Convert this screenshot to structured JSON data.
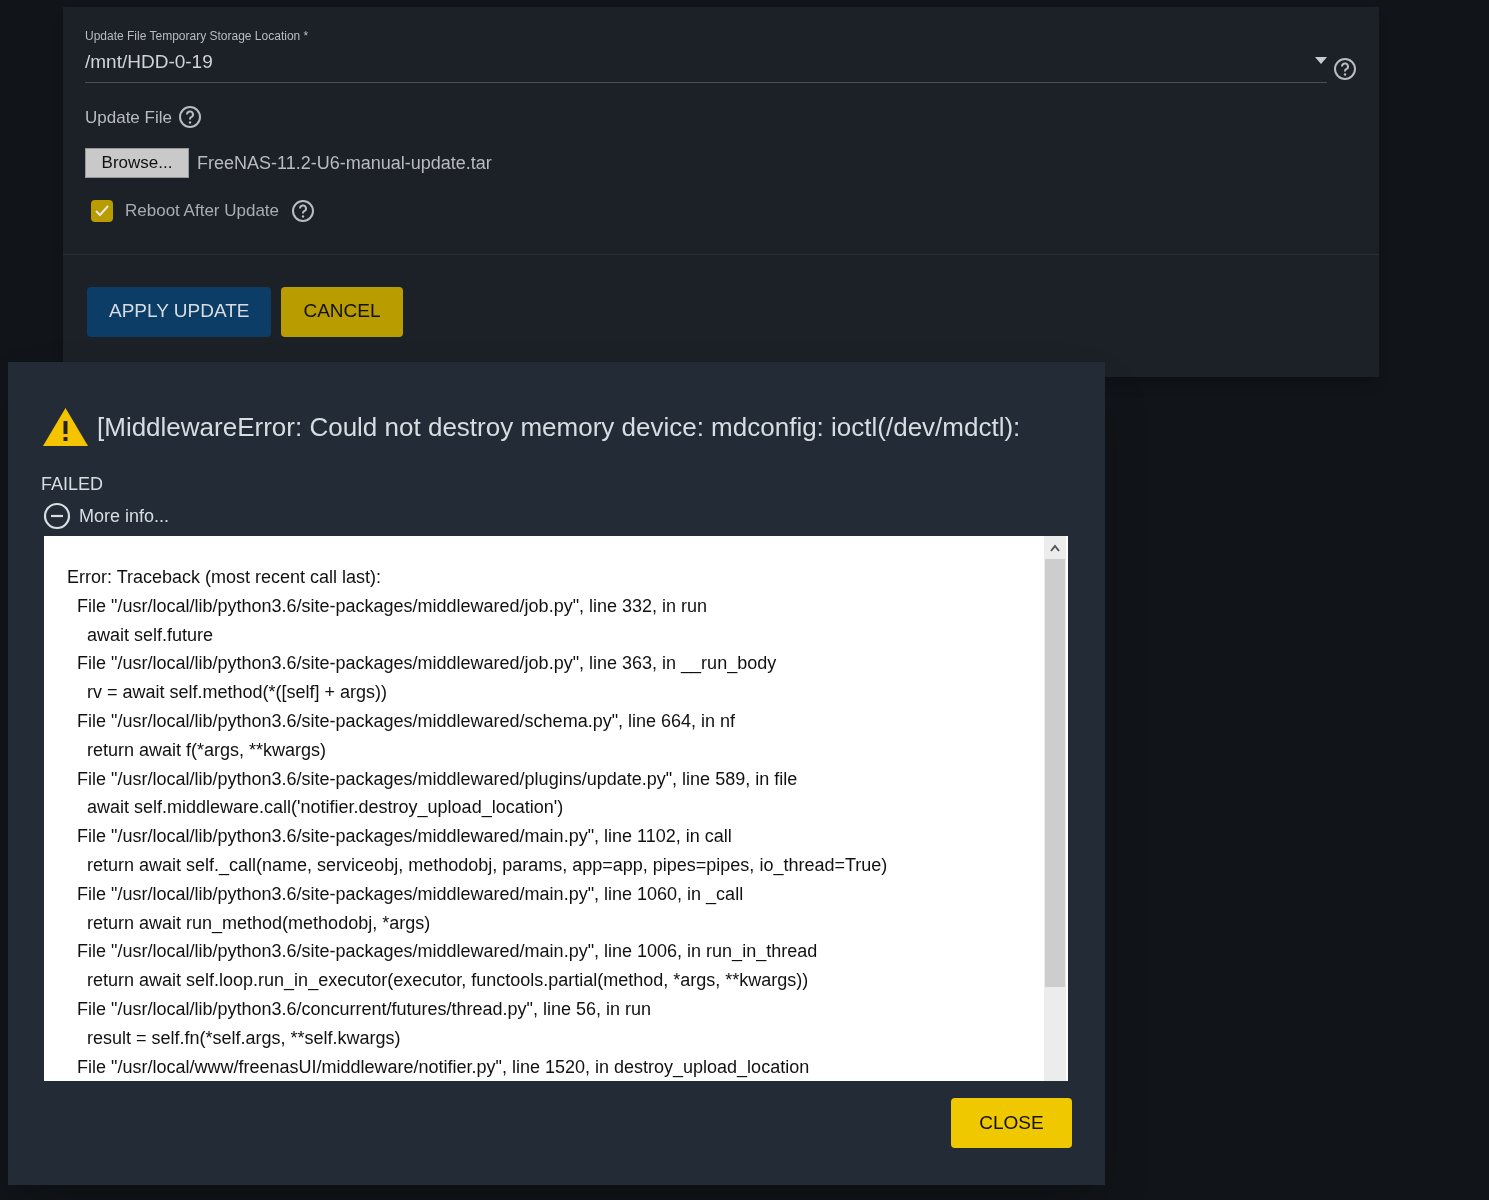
{
  "form": {
    "storage_location": {
      "label": "Update File Temporary Storage Location *",
      "value": "/mnt/HDD-0-19"
    },
    "update_file": {
      "label": "Update File",
      "browse_button": "Browse...",
      "file_name": "FreeNAS-11.2-U6-manual-update.tar"
    },
    "reboot_after_update": {
      "label": "Reboot After Update",
      "checked": true
    },
    "buttons": [
      {
        "label": "APPLY UPDATE",
        "kind": "primary"
      },
      {
        "label": "CANCEL",
        "kind": "secondary"
      }
    ]
  },
  "dialog": {
    "title": "[MiddlewareError: Could not destroy memory device: mdconfig: ioctl(/dev/mdctl):",
    "status": "FAILED",
    "more_info": {
      "label": "More info...",
      "expanded": true
    },
    "traceback": [
      "Error: Traceback (most recent call last):",
      "  File \"/usr/local/lib/python3.6/site-packages/middlewared/job.py\", line 332, in run",
      "    await self.future",
      "  File \"/usr/local/lib/python3.6/site-packages/middlewared/job.py\", line 363, in __run_body",
      "    rv = await self.method(*([self] + args))",
      "  File \"/usr/local/lib/python3.6/site-packages/middlewared/schema.py\", line 664, in nf",
      "    return await f(*args, **kwargs)",
      "  File \"/usr/local/lib/python3.6/site-packages/middlewared/plugins/update.py\", line 589, in file",
      "    await self.middleware.call('notifier.destroy_upload_location')",
      "  File \"/usr/local/lib/python3.6/site-packages/middlewared/main.py\", line 1102, in call",
      "    return await self._call(name, serviceobj, methodobj, params, app=app, pipes=pipes, io_thread=True)",
      "  File \"/usr/local/lib/python3.6/site-packages/middlewared/main.py\", line 1060, in _call",
      "    return await run_method(methodobj, *args)",
      "  File \"/usr/local/lib/python3.6/site-packages/middlewared/main.py\", line 1006, in run_in_thread",
      "    return await self.loop.run_in_executor(executor, functools.partial(method, *args, **kwargs))",
      "  File \"/usr/local/lib/python3.6/concurrent/futures/thread.py\", line 56, in run",
      "    result = self.fn(*self.args, **self.kwargs)",
      "  File \"/usr/local/www/freenasUI/middleware/notifier.py\", line 1520, in destroy_upload_location"
    ],
    "close_button": "CLOSE"
  }
}
